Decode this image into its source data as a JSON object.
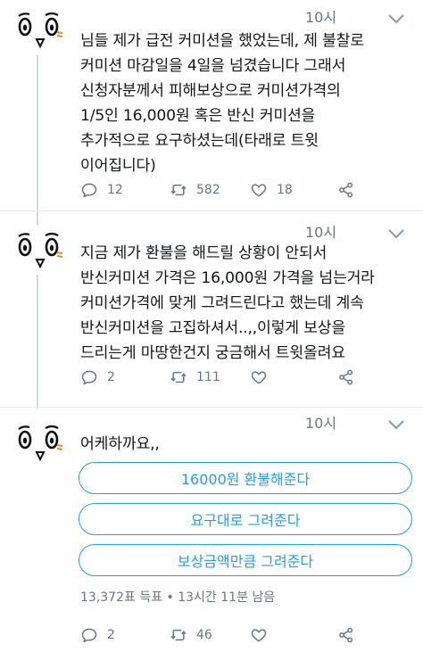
{
  "tweets": [
    {
      "time": "10시",
      "text": "님들 제가 급전 커미션을 했었는데, 제 불찰로\n커미션 마감일을 4일을 넘겼습니다 그래서\n신청자분께서 피해보상으로 커미션가격의\n1/5인 16,000원 혹은 반신 커미션을\n추가적으로 요구하셨는데(타래로 트윗\n이어집니다)",
      "replies": "12",
      "retweets": "582",
      "likes": "18"
    },
    {
      "time": "10시",
      "text": "지금 제가 환불을 해드릴 상황이 안되서\n반신커미션 가격은 16,000원 가격을 넘는거라\n커미션가격에 맞게 그려드린다고 했는데 계속\n반신커미션을 고집하셔서..,,이렇게 보상을\n드리는게 마땅한건지 궁금해서 트윗올려요",
      "replies": "2",
      "retweets": "111",
      "likes": ""
    },
    {
      "time": "10시",
      "text": "어케하까요,,",
      "poll": {
        "options": [
          "16000원 환불해준다",
          "요구대로 그려준다",
          "보상금액만큼 그려준다"
        ],
        "meta": "13,372표 득표 • 13시간 11분 남음"
      },
      "replies": "2",
      "retweets": "46",
      "likes": ""
    }
  ],
  "colors": {
    "accent": "#1da1f2",
    "muted": "#657786",
    "text": "#14171a"
  },
  "icons": [
    "reply-icon",
    "retweet-icon",
    "like-icon",
    "share-icon",
    "chevron-down-icon"
  ]
}
